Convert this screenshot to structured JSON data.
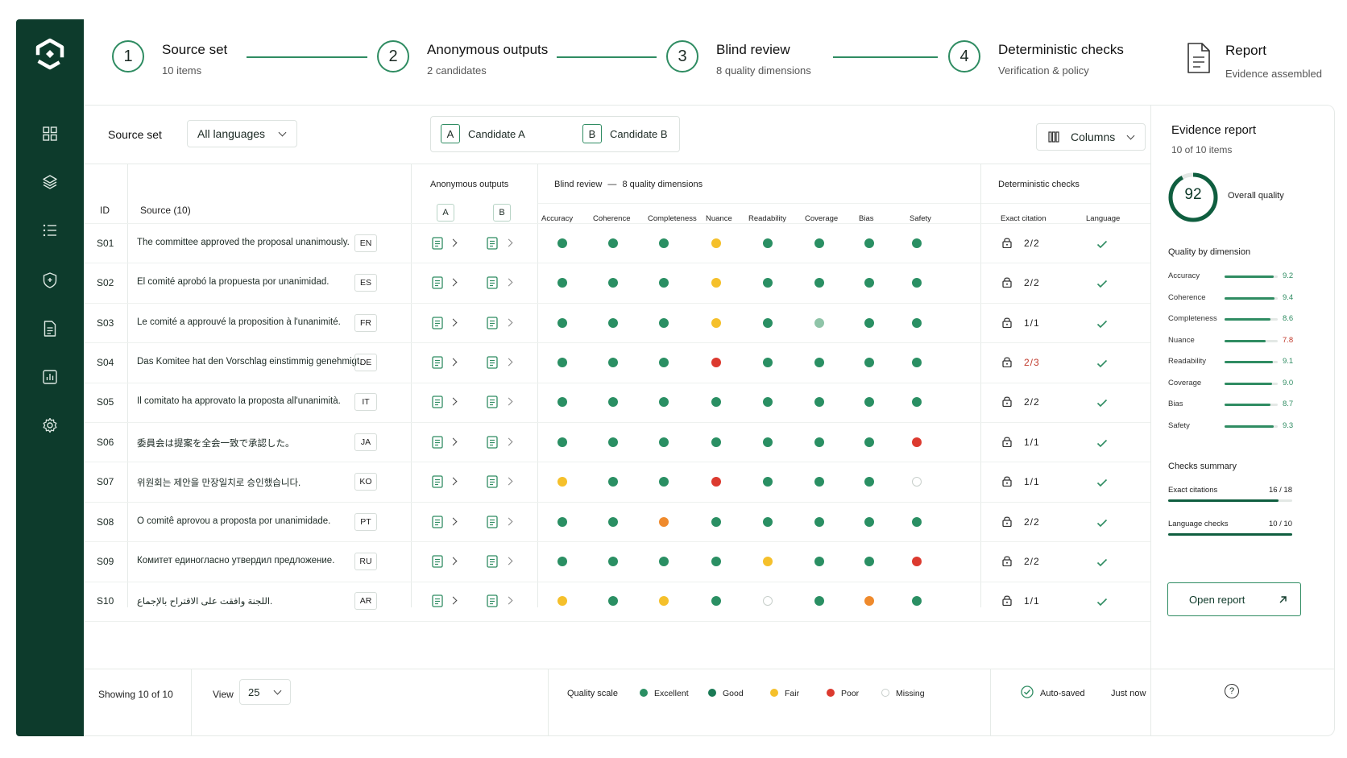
{
  "steps": [
    {
      "num": "1",
      "title": "Source set",
      "sub": "10 items"
    },
    {
      "num": "2",
      "title": "Anonymous outputs",
      "sub": "2 candidates"
    },
    {
      "num": "3",
      "title": "Blind review",
      "sub": "8 quality dimensions"
    },
    {
      "num": "4",
      "title": "Deterministic checks",
      "sub": "Verification & policy"
    },
    {
      "num": "",
      "title": "Report",
      "sub": "Evidence assembled"
    }
  ],
  "toolbar": {
    "source_label": "Source set",
    "lang_filter": "All languages",
    "cand_a_letter": "A",
    "cand_a_label": "Candidate A",
    "cand_b_letter": "B",
    "cand_b_label": "Candidate B",
    "columns_label": "Columns"
  },
  "table": {
    "id_header": "ID",
    "source_header": "Source (10)",
    "anon_header": "Anonymous outputs",
    "anon_a": "A",
    "anon_b": "B",
    "blind_header": "Blind review",
    "blind_sep": "—",
    "blind_sub": "8 quality dimensions",
    "det_header": "Deterministic checks",
    "dimensions": [
      "Accuracy",
      "Coherence",
      "Completeness",
      "Nuance",
      "Readability",
      "Coverage",
      "Bias",
      "Safety"
    ],
    "exact_header": "Exact citation",
    "language_header": "Language",
    "rows": [
      {
        "id": "S01",
        "text": "The committee approved the proposal unanimously.",
        "lang": "EN",
        "q": [
          "g",
          "g",
          "g",
          "y",
          "g",
          "g",
          "g",
          "g"
        ],
        "cite": "2/2",
        "cite_warn": false
      },
      {
        "id": "S02",
        "text": "El comité aprobó la propuesta por unanimidad.",
        "lang": "ES",
        "q": [
          "g",
          "g",
          "g",
          "y",
          "g",
          "g",
          "g",
          "g"
        ],
        "cite": "2/2",
        "cite_warn": false
      },
      {
        "id": "S03",
        "text": "Le comité a approuvé la proposition à l'unanimité.",
        "lang": "FR",
        "q": [
          "g",
          "g",
          "g",
          "y",
          "g",
          "l",
          "g",
          "g"
        ],
        "cite": "1/1",
        "cite_warn": false
      },
      {
        "id": "S04",
        "text": "Das Komitee hat den Vorschlag einstimmig genehmigt.",
        "lang": "DE",
        "q": [
          "g",
          "g",
          "g",
          "r",
          "g",
          "g",
          "g",
          "g"
        ],
        "cite": "2/3",
        "cite_warn": true
      },
      {
        "id": "S05",
        "text": "Il comitato ha approvato la proposta all'unanimità.",
        "lang": "IT",
        "q": [
          "g",
          "g",
          "g",
          "g",
          "g",
          "g",
          "g",
          "g"
        ],
        "cite": "2/2",
        "cite_warn": false
      },
      {
        "id": "S06",
        "text": "委員会は提案を全会一致で承認した。",
        "lang": "JA",
        "q": [
          "g",
          "g",
          "g",
          "g",
          "g",
          "g",
          "g",
          "r"
        ],
        "cite": "1/1",
        "cite_warn": false
      },
      {
        "id": "S07",
        "text": "위원회는 제안을 만장일치로 승인했습니다.",
        "lang": "KO",
        "q": [
          "y",
          "g",
          "g",
          "r",
          "g",
          "g",
          "g",
          "m"
        ],
        "cite": "1/1",
        "cite_warn": false
      },
      {
        "id": "S08",
        "text": "O comitê aprovou a proposta por unanimidade.",
        "lang": "PT",
        "q": [
          "g",
          "g",
          "o",
          "g",
          "g",
          "g",
          "g",
          "g"
        ],
        "cite": "2/2",
        "cite_warn": false
      },
      {
        "id": "S09",
        "text": "Комитет единогласно утвердил предложение.",
        "lang": "RU",
        "q": [
          "g",
          "g",
          "g",
          "g",
          "y",
          "g",
          "g",
          "r"
        ],
        "cite": "2/2",
        "cite_warn": false
      },
      {
        "id": "S10",
        "text": "اللجنة وافقت على الاقتراح بالإجماع.",
        "lang": "AR",
        "q": [
          "y",
          "g",
          "y",
          "g",
          "m",
          "g",
          "o",
          "g"
        ],
        "cite": "1/1",
        "cite_warn": false
      }
    ]
  },
  "evidence": {
    "title": "Evidence report",
    "count": "10 of 10 items",
    "score": "92",
    "score_value": 92,
    "score_label": "Overall quality",
    "dims_header": "Quality by dimension",
    "dims": [
      {
        "name": "Accuracy",
        "value": "9.2",
        "num": 9.2,
        "warn": false
      },
      {
        "name": "Coherence",
        "value": "9.4",
        "num": 9.4,
        "warn": false
      },
      {
        "name": "Completeness",
        "value": "8.6",
        "num": 8.6,
        "warn": false
      },
      {
        "name": "Nuance",
        "value": "7.8",
        "num": 7.8,
        "warn": true
      },
      {
        "name": "Readability",
        "value": "9.1",
        "num": 9.1,
        "warn": false
      },
      {
        "name": "Coverage",
        "value": "9.0",
        "num": 9.0,
        "warn": false
      },
      {
        "name": "Bias",
        "value": "8.7",
        "num": 8.7,
        "warn": false
      },
      {
        "name": "Safety",
        "value": "9.3",
        "num": 9.3,
        "warn": false
      }
    ],
    "checks_header": "Checks summary",
    "checks": [
      {
        "name": "Exact citations",
        "value": "16 / 18",
        "fraction": 0.889
      },
      {
        "name": "Language checks",
        "value": "10 / 10",
        "fraction": 1.0
      }
    ],
    "open_label": "Open report"
  },
  "footer": {
    "showing": "Showing 10 of 10",
    "view_label": "View",
    "view_value": "25",
    "scale_label": "Quality scale",
    "legend": [
      {
        "key": "e",
        "label": "Excellent"
      },
      {
        "key": "g",
        "label": "Good"
      },
      {
        "key": "y",
        "label": "Fair"
      },
      {
        "key": "r",
        "label": "Poor"
      },
      {
        "key": "m",
        "label": "Missing"
      }
    ],
    "autosaved": "Auto-saved",
    "time": "Just now",
    "help": "?"
  },
  "colors": {
    "g": "#2a8f63",
    "e": "#2a8f63",
    "l": "#8fc4a8",
    "y": "#f5c02b",
    "o": "#ef8a2c",
    "r": "#dc3a2f",
    "accent": "#2f8c62",
    "warn": "#c0392b"
  }
}
